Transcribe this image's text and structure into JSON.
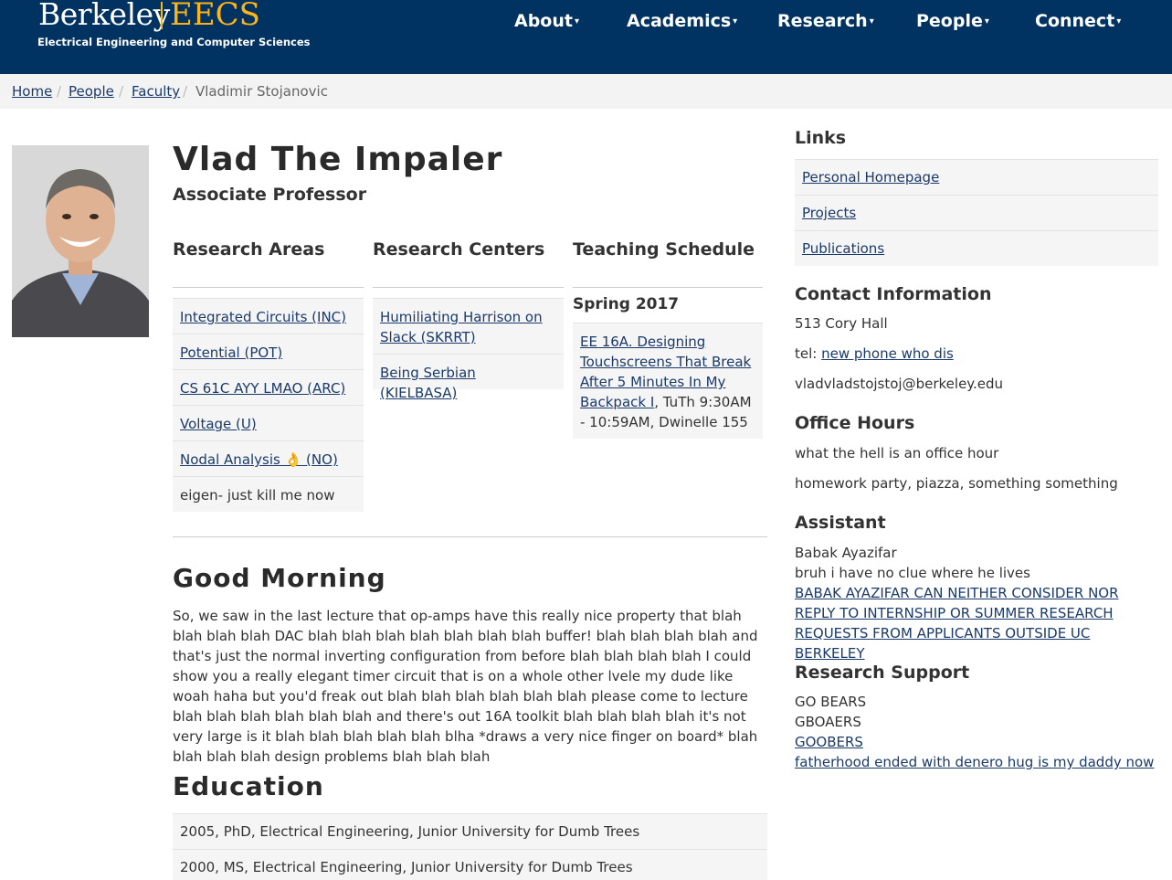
{
  "header": {
    "logo_berkeley": "Berkeley",
    "logo_eecs": "EECS",
    "logo_subtitle": "Electrical Engineering and Computer Sciences",
    "nav": [
      "About",
      "Academics",
      "Research",
      "People",
      "Connect"
    ]
  },
  "breadcrumb": {
    "items": [
      "Home",
      "People",
      "Faculty"
    ],
    "current": "Vladimir Stojanovic"
  },
  "profile": {
    "name": "Vlad The Impaler",
    "title": "Associate Professor"
  },
  "research_areas": {
    "heading": "Research Areas",
    "items": [
      "Integrated Circuits (INC)",
      "Potential (POT)",
      "CS 61C AYY LMAO (ARC)",
      "Voltage (U)",
      "Nodal Analysis 👌 (NO)"
    ],
    "plain_item": "eigen- just kill me now"
  },
  "research_centers": {
    "heading": "Research Centers",
    "items": [
      "Humiliating Harrison on Slack (SKRRT)",
      "Being Serbian (KIELBASA)"
    ]
  },
  "teaching": {
    "heading": "Teaching Schedule",
    "semester": "Spring 2017",
    "course_link": "EE 16A. Designing Touchscreens That Break After 5 Minutes In My Backpack I",
    "course_info": ", TuTh 9:30AM - 10:59AM, Dwinelle 155"
  },
  "good_morning": {
    "heading": "Good Morning",
    "text": "So, we saw in the last lecture that op-amps have this really nice property that blah blah blah blah DAC blah blah blah blah blah blah blah buffer! blah blah blah blah and that's just the normal inverting configuration from before blah blah blah blah I could show you a really elegant timer circuit that is on a whole other lvele my dude like woah haha but you'd freak out blah blah blah blah blah blah please come to lecture blah blah blah blah blah blah and there's out 16A toolkit blah blah blah blah it's not very large is it blah blah blah blah blah blha *draws a very nice finger on board* blah blah blah blah design problems blah blah blah"
  },
  "education": {
    "heading": "Education",
    "items": [
      "2005, PhD, Electrical Engineering, Junior University for Dumb Trees",
      "2000, MS, Electrical Engineering, Junior University for Dumb Trees"
    ]
  },
  "links": {
    "heading": "Links",
    "items": [
      "Personal Homepage",
      "Projects",
      "Publications"
    ]
  },
  "contact": {
    "heading": "Contact Information",
    "office": "513 Cory Hall",
    "tel_label": "tel: ",
    "tel_link": "new phone who dis",
    "email": "vladvladstojstoj@berkeley.edu"
  },
  "office_hours": {
    "heading": "Office Hours",
    "lines": [
      "what the hell is an office hour",
      "homework party, piazza, something something"
    ]
  },
  "assistant": {
    "heading": "Assistant",
    "name": "Babak Ayazifar",
    "note": "bruh i have no clue where he lives",
    "link": "BABAK AYAZIFAR CAN NEITHER CONSIDER NOR REPLY TO INTERNSHIP OR SUMMER RESEARCH REQUESTS FROM APPLICANTS OUTSIDE UC BERKELEY"
  },
  "research_support": {
    "heading": "Research Support",
    "lines": [
      "GO BEARS",
      "GBOAERS"
    ],
    "links": [
      "GOOBERS",
      "fatherhood ended with denero hug is my daddy now"
    ]
  },
  "colors": {
    "header_bg": "#003262",
    "gold": "#fdb515",
    "link": "#1a3a6b"
  }
}
